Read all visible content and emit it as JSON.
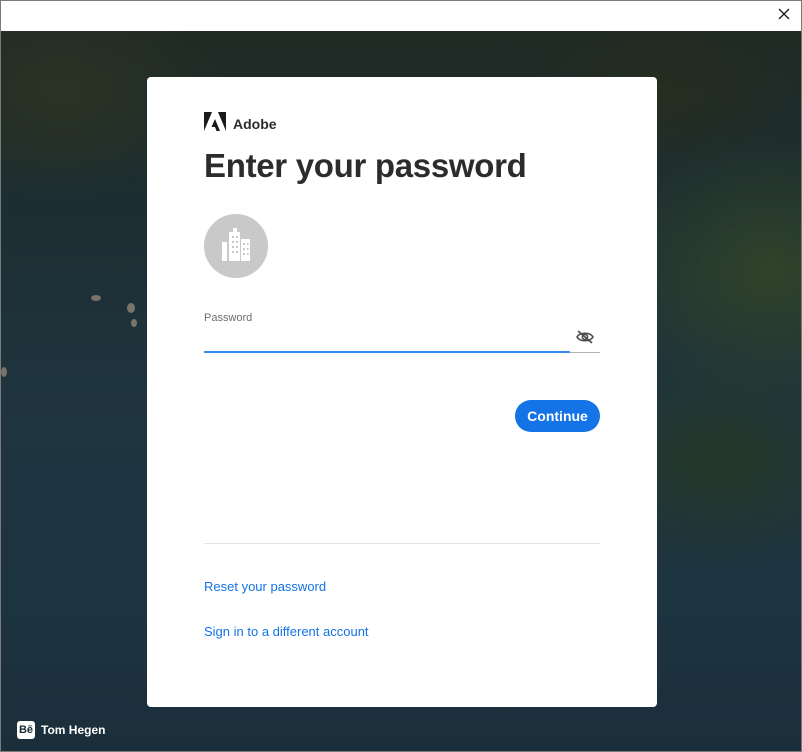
{
  "window": {
    "close_icon": "close-icon"
  },
  "background": {
    "credit": {
      "icon": "behance-logo",
      "logo_text": "Bē",
      "name": "Tom Hegen"
    }
  },
  "card": {
    "brand": {
      "logo": "adobe-logo",
      "name": "Adobe"
    },
    "heading": "Enter your password",
    "avatar_icon": "building-icon",
    "password": {
      "label": "Password",
      "value": "",
      "placeholder": "",
      "toggle_icon": "eye-slash-icon"
    },
    "continue_label": "Continue",
    "links": {
      "reset": "Reset your password",
      "switch_account": "Sign in to a different account"
    }
  },
  "colors": {
    "accent": "#1473e6",
    "input_focus": "#378ef0",
    "avatar_bg": "#c9c9c9",
    "heading_text": "#2c2c2c"
  }
}
